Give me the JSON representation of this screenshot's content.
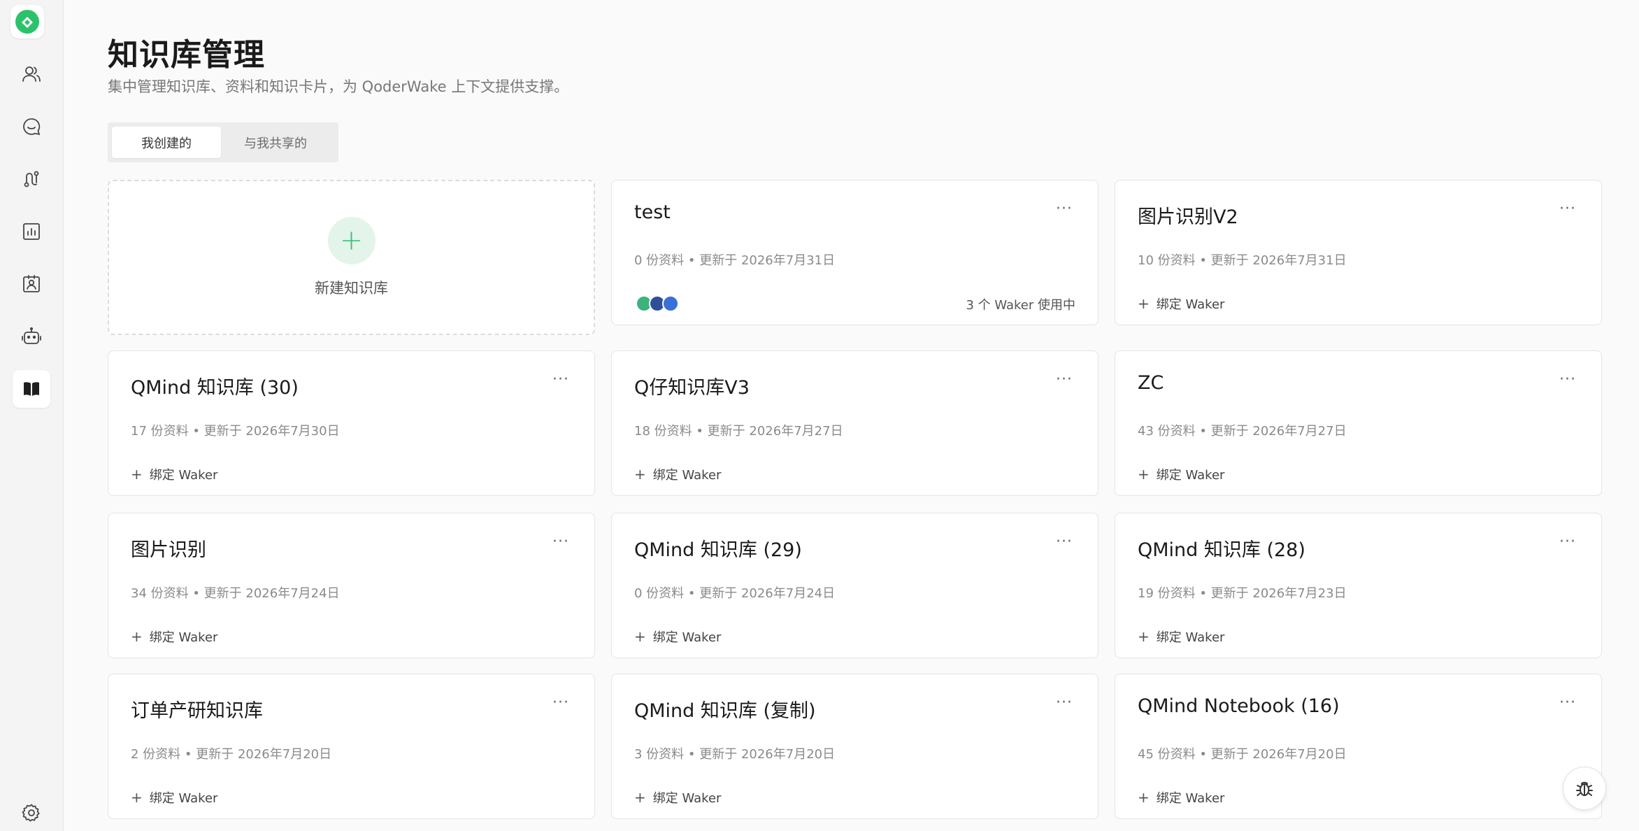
{
  "sidebar": {
    "brand_color": "#2bc26b",
    "items": [
      {
        "icon": "users-icon"
      },
      {
        "icon": "chat-icon"
      },
      {
        "icon": "workflow-icon"
      },
      {
        "icon": "chart-icon"
      },
      {
        "icon": "contact-card-icon"
      },
      {
        "icon": "robot-icon"
      },
      {
        "icon": "book-icon",
        "active": true
      }
    ],
    "settings_icon": "gear-icon"
  },
  "header": {
    "title": "知识库管理",
    "subtitle": "集中管理知识库、资料和知识卡片，为 QoderWake 上下文提供支撑。"
  },
  "tabs": [
    {
      "label": "我创建的",
      "active": true
    },
    {
      "label": "与我共享的",
      "active": false
    }
  ],
  "new_card": {
    "plus": "+",
    "label": "新建知识库"
  },
  "more_label": "···",
  "bind_label": "绑定 Waker",
  "cards": [
    {
      "title": "test",
      "meta": "0 份资料 • 更新于 2026年7月31日",
      "usage": "3 个 Waker 使用中"
    },
    {
      "title": "图片识别V2",
      "meta": "10 份资料 • 更新于 2026年7月31日"
    },
    {
      "title": "QMind 知识库 (30)",
      "meta": "17 份资料 • 更新于 2026年7月30日"
    },
    {
      "title": "Q仔知识库V3",
      "meta": "18 份资料 • 更新于 2026年7月27日"
    },
    {
      "title": "ZC",
      "meta": "43 份资料 • 更新于 2026年7月27日"
    },
    {
      "title": "图片识别",
      "meta": "34 份资料 • 更新于 2026年7月24日"
    },
    {
      "title": "QMind 知识库 (29)",
      "meta": "0 份资料 • 更新于 2026年7月24日"
    },
    {
      "title": "QMind 知识库 (28)",
      "meta": "19 份资料 • 更新于 2026年7月23日"
    },
    {
      "title": "订单产研知识库",
      "meta": "2 份资料 • 更新于 2026年7月20日"
    },
    {
      "title": "QMind 知识库 (复制)",
      "meta": "3 份资料 • 更新于 2026年7月20日"
    },
    {
      "title": "QMind Notebook (16)",
      "meta": "45 份资料 • 更新于 2026年7月20日"
    }
  ],
  "avatar_colors": [
    "#3bb37a",
    "#2f4f9e",
    "#3a6fd8"
  ],
  "fab_icon": "bug-icon"
}
